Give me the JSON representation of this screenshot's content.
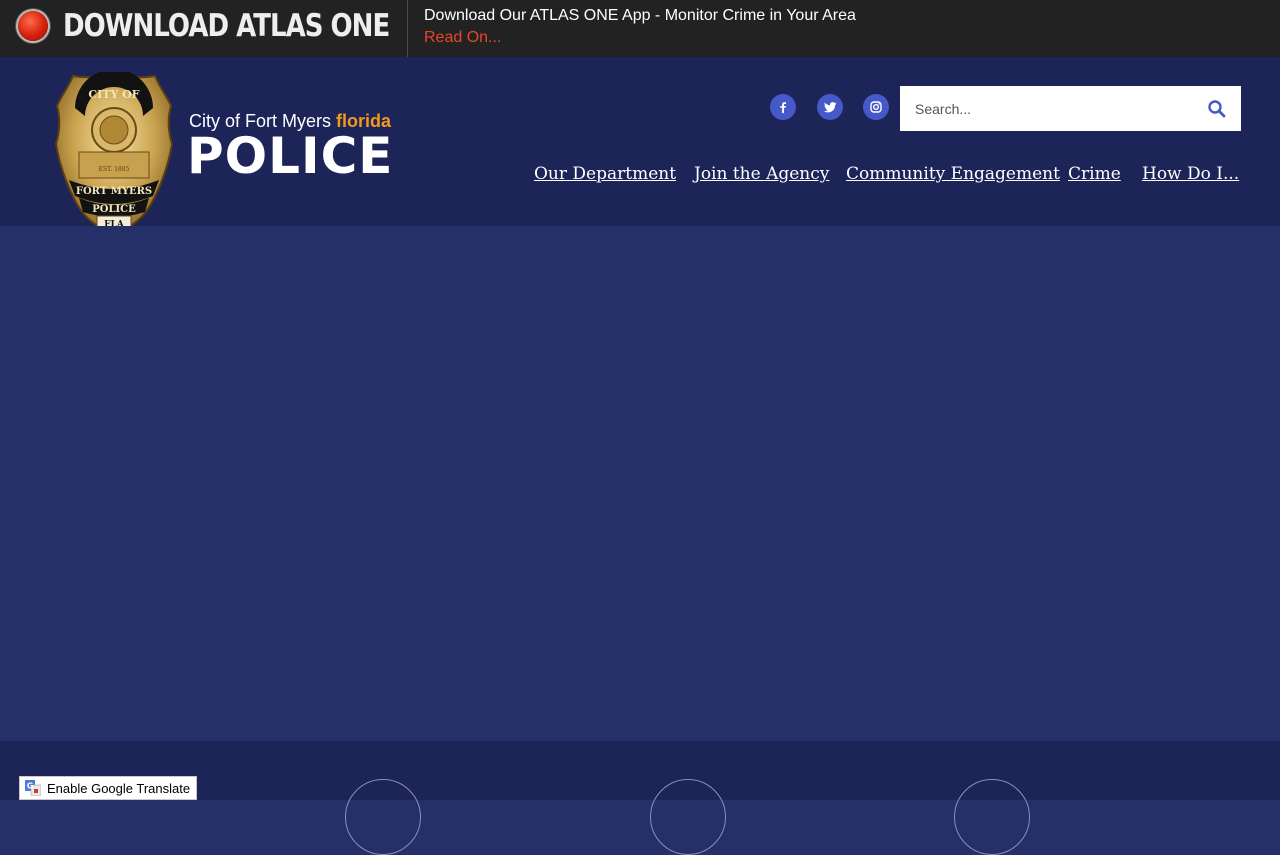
{
  "alert": {
    "title": "DOWNLOAD ATLAS ONE",
    "message": "Download Our ATLAS ONE App - Monitor Crime in Your Area",
    "link": "Read On..."
  },
  "logo": {
    "city_text": "City of Fort Myers",
    "state_text": "florida",
    "police_text": "POLICE",
    "badge_top": "CITY OF",
    "badge_name": "FORT MYERS",
    "badge_police": "POLICE",
    "badge_est": "EST. 1885",
    "badge_state": "FLA"
  },
  "social": [
    {
      "icon": "facebook-icon"
    },
    {
      "icon": "twitter-icon"
    },
    {
      "icon": "instagram-icon"
    }
  ],
  "search": {
    "placeholder": "Search..."
  },
  "nav": {
    "items": [
      {
        "label": "Our Department"
      },
      {
        "label": "Join the Agency"
      },
      {
        "label": "Community Engagement"
      },
      {
        "label": "Crime"
      },
      {
        "label": "How Do I..."
      }
    ]
  },
  "translate": {
    "label": "Enable Google Translate"
  },
  "colors": {
    "alert_bg": "#222222",
    "header_bg": "#1c2458",
    "hero_bg": "#252f68",
    "accent_orange": "#f29a1e",
    "link_red": "#e8452c",
    "social_blue": "#4659c8"
  }
}
